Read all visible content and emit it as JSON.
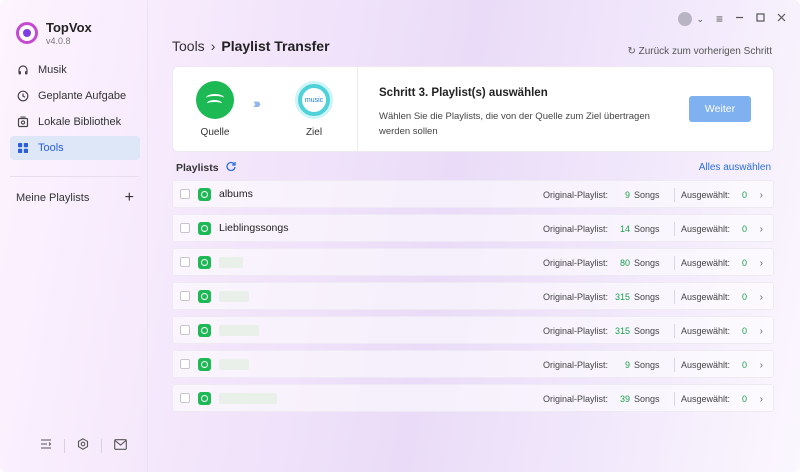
{
  "app": {
    "name": "TopVox",
    "version": "v4.0.8"
  },
  "sidebar": {
    "items": [
      {
        "label": "Musik",
        "icon": "headphones-icon"
      },
      {
        "label": "Geplante Aufgabe",
        "icon": "clock-icon"
      },
      {
        "label": "Lokale Bibliothek",
        "icon": "library-icon"
      },
      {
        "label": "Tools",
        "icon": "grid-icon",
        "active": true
      }
    ],
    "playlists_label": "Meine Playlists",
    "add_icon": "plus-icon",
    "bottom_icons": [
      "collapse-icon",
      "settings-icon",
      "mail-icon"
    ]
  },
  "titlebar": {
    "icons": [
      "avatar-icon",
      "chevron-down-icon",
      "menu-icon",
      "minimize-icon",
      "maximize-icon",
      "close-icon"
    ]
  },
  "header": {
    "breadcrumb_root": "Tools",
    "breadcrumb_sep": "›",
    "breadcrumb_current": "Playlist Transfer",
    "back_link": "↻ Zurück zum vorherigen Schritt"
  },
  "step_card": {
    "source_label": "Quelle",
    "target_label": "Ziel",
    "target_logo_text": "music",
    "arrows": "›››",
    "title": "Schritt 3. Playlist(s) auswählen",
    "description": "Wählen Sie die Playlists, die von der Quelle zum Ziel übertragen werden sollen",
    "button": "Weiter"
  },
  "playlists": {
    "title": "Playlists",
    "select_all": "Alles auswählen",
    "orig_label": "Original-Playlist:",
    "songs_label": "Songs",
    "selected_label": "Ausgewählt:",
    "rows": [
      {
        "name": "albums",
        "count": "9",
        "selected": "0",
        "blur_width": 0
      },
      {
        "name": "Lieblingssongs",
        "count": "14",
        "selected": "0",
        "blur_width": 0
      },
      {
        "name": "",
        "count": "80",
        "selected": "0",
        "blur_width": 24
      },
      {
        "name": "",
        "count": "315",
        "selected": "0",
        "blur_width": 30
      },
      {
        "name": "",
        "count": "315",
        "selected": "0",
        "blur_width": 40
      },
      {
        "name": "",
        "count": "9",
        "selected": "0",
        "blur_width": 30
      },
      {
        "name": "",
        "count": "39",
        "selected": "0",
        "blur_width": 58
      }
    ]
  },
  "colors": {
    "accent": "#2b6fe0",
    "spotify": "#1db954",
    "button": "#7fb0f0",
    "count": "#1aa34a"
  }
}
